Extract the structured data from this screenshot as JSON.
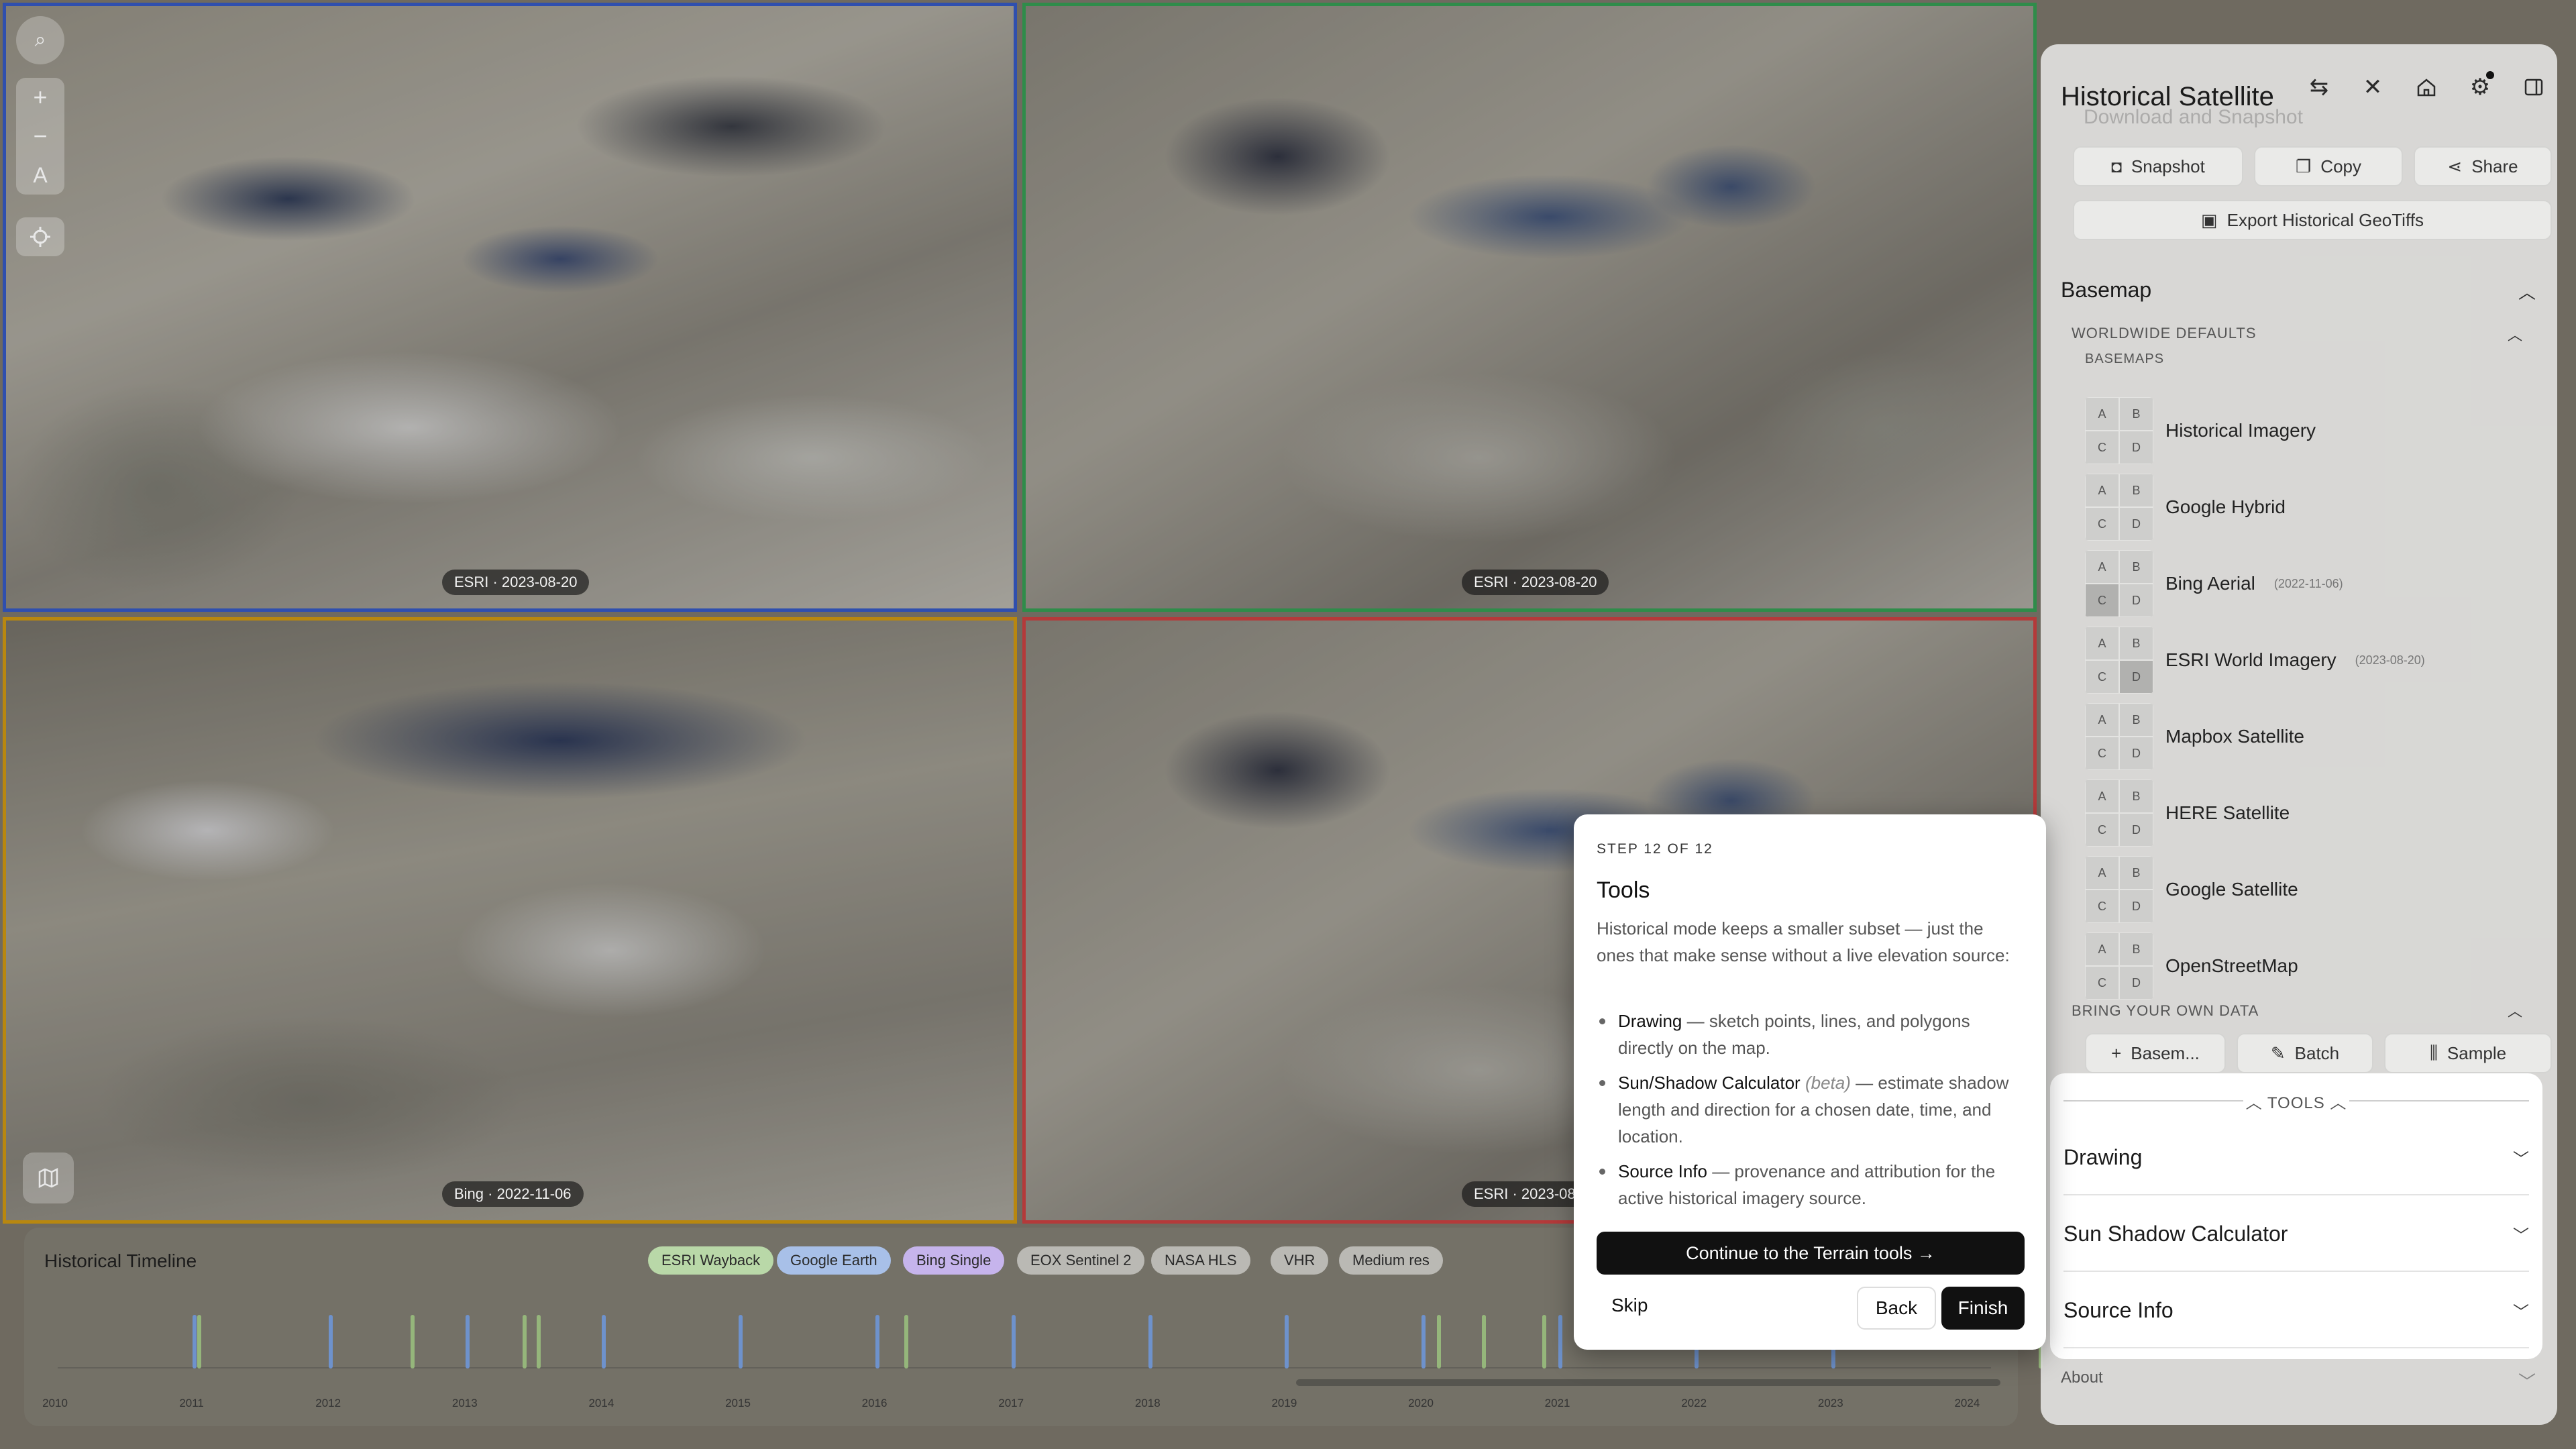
{
  "maps": [
    {
      "label": "ESRI · 2023-08-20",
      "border": "#2f4fae"
    },
    {
      "label": "ESRI · 2023-08-20",
      "border": "#2f8c4a"
    },
    {
      "label": "Bing · 2022-11-06",
      "border": "#b8870f"
    },
    {
      "label": "ESRI · 2023-08-",
      "border": "#b43a3a"
    }
  ],
  "map_controls": {
    "icons": [
      "search-icon",
      "zoom-in-icon",
      "zoom-out-icon",
      "compass-icon",
      "locate-icon",
      "layers-icon"
    ],
    "zoom_in": "+",
    "zoom_out": "−",
    "north": "A"
  },
  "timeline": {
    "title": "Historical Timeline",
    "sources": [
      {
        "label": "ESRI Wayback",
        "color": "#b9d8a8"
      },
      {
        "label": "Google Earth",
        "color": "#a8c0e8"
      },
      {
        "label": "Bing Single",
        "color": "#c6b4ec"
      },
      {
        "label": "EOX Sentinel 2",
        "color": "#d8d8d6"
      },
      {
        "label": "NASA HLS",
        "color": "#d8d8d6"
      },
      {
        "label": "VHR",
        "color": "#d8d8d6"
      },
      {
        "label": "Medium res",
        "color": "#d8d8d6"
      }
    ],
    "years": [
      "2010",
      "2011",
      "2012",
      "2013",
      "2014",
      "2015",
      "2016",
      "2017",
      "2018",
      "2019",
      "2020",
      "2021",
      "2022",
      "2023",
      "2024"
    ]
  },
  "panel": {
    "title": "Historical Satellite",
    "icons": [
      "swap-icon",
      "collapse-icon",
      "home-icon",
      "gear-icon",
      "sidebar-icon"
    ],
    "truncated_heading": "Download and Snapshot",
    "snapshot": "Snapshot",
    "copy": "Copy",
    "share": "Share",
    "export": "Export Historical GeoTiffs",
    "basemap_title": "Basemap",
    "worldwide_defaults": "WORLDWIDE DEFAULTS",
    "basemaps_caption": "BASEMAPS",
    "basemaps": [
      {
        "name": "Historical Imagery",
        "date": ""
      },
      {
        "name": "Google Hybrid",
        "date": ""
      },
      {
        "name": "Bing Aerial",
        "date": "(2022-11-06)"
      },
      {
        "name": "ESRI World Imagery",
        "date": "(2023-08-20)"
      },
      {
        "name": "Mapbox Satellite",
        "date": ""
      },
      {
        "name": "HERE Satellite",
        "date": ""
      },
      {
        "name": "Google Satellite",
        "date": ""
      },
      {
        "name": "OpenStreetMap",
        "date": ""
      }
    ],
    "grid_letters": [
      "A",
      "B",
      "C",
      "D"
    ],
    "byod": "BRING YOUR OWN DATA",
    "basemap_btn": "Basem...",
    "batch_btn": "Batch",
    "sample_btn": "Sample",
    "tools_label": "TOOLS",
    "tools": [
      "Drawing",
      "Sun Shadow Calculator",
      "Source Info"
    ],
    "about": "About"
  },
  "tour": {
    "step": "STEP 12 OF 12",
    "title": "Tools",
    "intro": "Historical mode keeps a smaller subset — just the ones that make sense without a live elevation source:",
    "items": [
      {
        "name": "Drawing",
        "beta": "",
        "desc": " — sketch points, lines, and polygons directly on the map."
      },
      {
        "name": "Sun/Shadow Calculator",
        "beta": "(beta)",
        "desc": " — estimate shadow length and direction for a chosen date, time, and location."
      },
      {
        "name": "Source Info",
        "beta": "",
        "desc": " — provenance and attribution for the active historical imagery source."
      }
    ],
    "continue": "Continue to the Terrain tools →",
    "skip": "Skip",
    "back": "Back",
    "finish": "Finish"
  }
}
